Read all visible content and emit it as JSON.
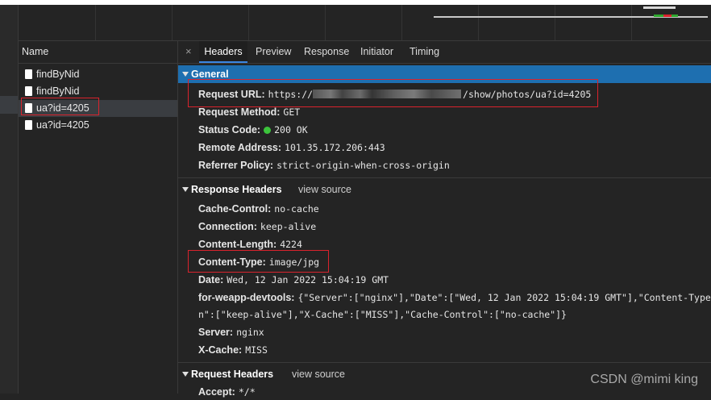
{
  "name_column": {
    "header": "Name",
    "requests": [
      {
        "label": "findByNid"
      },
      {
        "label": "findByNid"
      },
      {
        "label": "ua?id=4205",
        "selected": true
      },
      {
        "label": "ua?id=4205"
      }
    ]
  },
  "tabs": {
    "close": "×",
    "items": [
      "Headers",
      "Preview",
      "Response",
      "Initiator",
      "Timing"
    ],
    "active": "Headers"
  },
  "general": {
    "title": "General",
    "request_url_label": "Request URL:",
    "request_url_prefix": "https://",
    "request_url_suffix": "/show/photos/ua?id=4205",
    "request_method_label": "Request Method:",
    "request_method": "GET",
    "status_code_label": "Status Code:",
    "status_code": "200 OK",
    "remote_address_label": "Remote Address:",
    "remote_address": "101.35.172.206:443",
    "referrer_policy_label": "Referrer Policy:",
    "referrer_policy": "strict-origin-when-cross-origin"
  },
  "response_headers": {
    "title": "Response Headers",
    "view_source": "view source",
    "cache_control_label": "Cache-Control:",
    "cache_control": "no-cache",
    "connection_label": "Connection:",
    "connection": "keep-alive",
    "content_length_label": "Content-Length:",
    "content_length": "4224",
    "content_type_label": "Content-Type:",
    "content_type": "image/jpg",
    "date_label": "Date:",
    "date": "Wed, 12 Jan 2022 15:04:19 GMT",
    "devtools_label": "for-weapp-devtools:",
    "devtools_line1": "{\"Server\":[\"nginx\"],\"Date\":[\"Wed, 12 Jan 2022 15:04:19 GMT\"],\"Content-Type\":[",
    "devtools_line2": "n\":[\"keep-alive\"],\"X-Cache\":[\"MISS\"],\"Cache-Control\":[\"no-cache\"]}",
    "server_label": "Server:",
    "server": "nginx",
    "xcache_label": "X-Cache:",
    "xcache": "MISS"
  },
  "request_headers": {
    "title": "Request Headers",
    "view_source": "view source",
    "accept_label": "Accept:",
    "accept": "*/*"
  },
  "watermark": "CSDN @mimi king",
  "colors": {
    "general_bar": "#1e6fb0",
    "annotation": "#d9232d",
    "status_ok": "#3cc43c"
  }
}
